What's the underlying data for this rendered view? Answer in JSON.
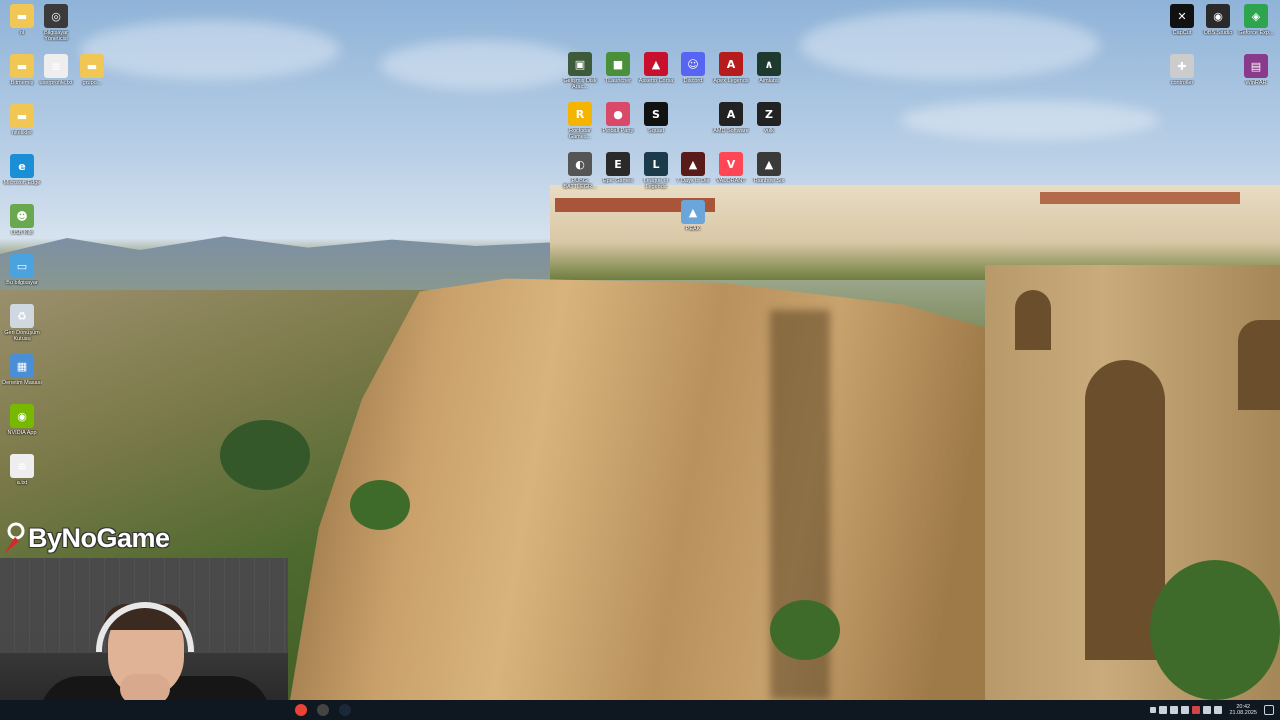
{
  "colors": {
    "taskbar_bg": "#0f1720",
    "icon_label": "#ffffff"
  },
  "desktop": {
    "icons_left": [
      {
        "label": "ol",
        "icon": "folder-icon",
        "color": "#f0c654"
      },
      {
        "label": "Bilgisayar Yöneticisi",
        "icon": "app-circle-icon",
        "color": "#3a3a3a"
      },
      {
        "label": "Bitmemiş",
        "icon": "folder-icon",
        "color": "#f0c654"
      },
      {
        "label": "userprofile.txt",
        "icon": "text-file-icon",
        "color": "#eeeeee"
      },
      {
        "label": "grupo...",
        "icon": "folder-icon",
        "color": "#f0c654"
      },
      {
        "label": "nitelikler",
        "icon": "folder-icon",
        "color": "#f0c654"
      },
      {
        "label": "Microsoft Edge",
        "icon": "edge-icon",
        "color": "#1a8fd6"
      },
      {
        "label": "USB Kilit",
        "icon": "user-icon",
        "color": "#6aa84f"
      },
      {
        "label": "Bu bilgisayar",
        "icon": "computer-icon",
        "color": "#4aa3df"
      },
      {
        "label": "Geri Dönüşüm Kutusu",
        "icon": "recycle-bin-icon",
        "color": "#cfd8e0"
      },
      {
        "label": "Denetim Masası",
        "icon": "control-panel-icon",
        "color": "#4a8fd6"
      },
      {
        "label": "NVIDIA App",
        "icon": "nvidia-icon",
        "color": "#76b900"
      },
      {
        "label": "a.txt",
        "icon": "text-file-icon",
        "color": "#eeeeee"
      }
    ],
    "icons_center": [
      {
        "label": "Gelişmiş Disk Arac...",
        "icon": "disk-icon",
        "color": "#3d5a3a"
      },
      {
        "label": "TLauncher",
        "icon": "minecraft-icon",
        "color": "#4a8f3a"
      },
      {
        "label": "Assetto Corsa",
        "icon": "game-icon",
        "color": "#c8102e"
      },
      {
        "label": "Discord",
        "icon": "discord-icon",
        "color": "#5865f2"
      },
      {
        "label": "Apex Legends",
        "icon": "apex-icon",
        "color": "#b71c1c"
      },
      {
        "label": "Aimlabs",
        "icon": "aimlabs-icon",
        "color": "#1e3a2f"
      },
      {
        "label": "Rockstar Games...",
        "icon": "rockstar-icon",
        "color": "#f5b400"
      },
      {
        "label": "Pinball Party",
        "icon": "pinball-icon",
        "color": "#d94a6a"
      },
      {
        "label": "Squad",
        "icon": "squad-icon",
        "color": "#111111"
      },
      {
        "label": "AMD Software",
        "icon": "amd-icon",
        "color": "#222222"
      },
      {
        "label": "vulk",
        "icon": "z-icon",
        "color": "#222222"
      },
      {
        "label": "PUBG: BATTLEGR...",
        "icon": "helmet-icon",
        "color": "#555555"
      },
      {
        "label": "Epic Games",
        "icon": "epic-icon",
        "color": "#2a2a2a"
      },
      {
        "label": "League of Legends",
        "icon": "league-icon",
        "color": "#1b3a4a"
      },
      {
        "label": "7 Days to Die",
        "icon": "game-icon",
        "color": "#5a1a1a"
      },
      {
        "label": "VALORANT",
        "icon": "valorant-icon",
        "color": "#ff4655"
      },
      {
        "label": "Rainbow Six",
        "icon": "game-icon",
        "color": "#3a3a3a"
      },
      {
        "label": "PEAK",
        "icon": "peak-icon",
        "color": "#6aa6d9"
      }
    ],
    "icons_right": [
      {
        "label": "CapCut",
        "icon": "capcut-icon",
        "color": "#111111"
      },
      {
        "label": "OBS Studio",
        "icon": "obs-icon",
        "color": "#2a2a2a"
      },
      {
        "label": "Geforce Exp...",
        "icon": "geforce-icon",
        "color": "#2ea44f"
      },
      {
        "label": "controller",
        "icon": "gamepad-icon",
        "color": "#cccccc"
      },
      {
        "label": "WinRAR",
        "icon": "winrar-icon",
        "color": "#8a3a8a"
      }
    ]
  },
  "overlay": {
    "brand_name": "ByNoGame"
  },
  "taskbar": {
    "apps": [
      {
        "name": "chrome",
        "color": "#ea4335"
      },
      {
        "name": "obs",
        "color": "#444444"
      },
      {
        "name": "steam",
        "color": "#1b2838"
      }
    ],
    "clock_time": "20:42",
    "clock_date": "21.08.2025"
  }
}
